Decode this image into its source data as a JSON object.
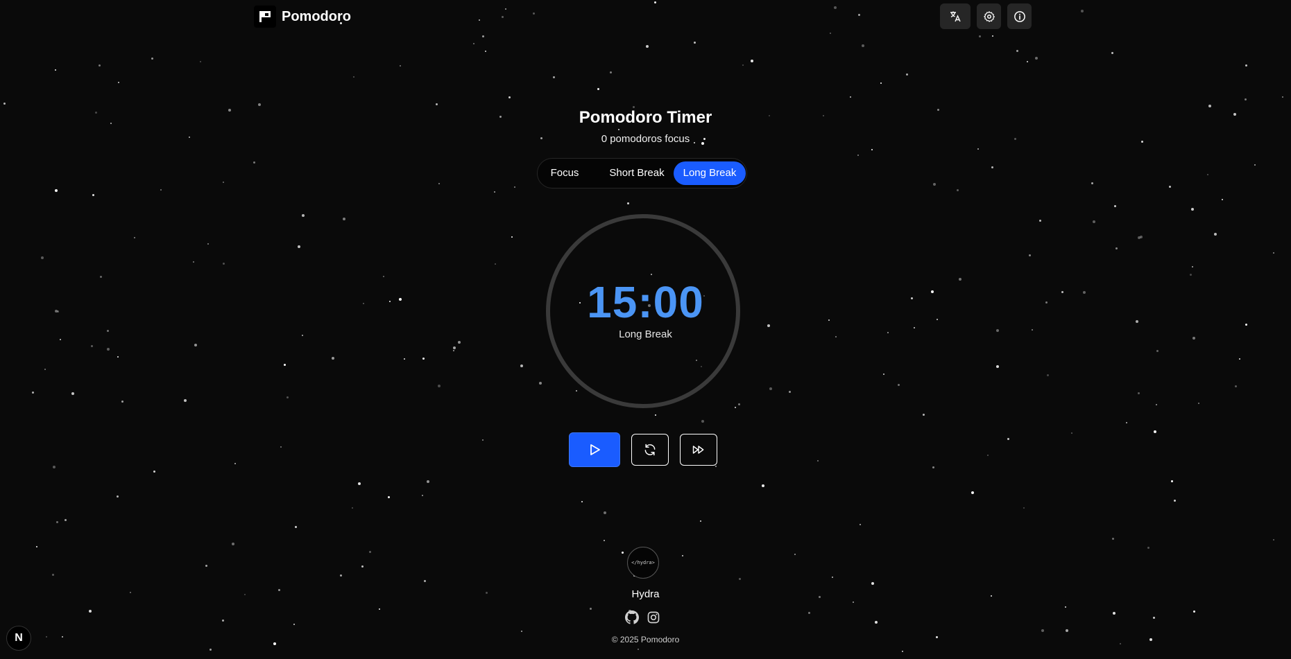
{
  "header": {
    "brand_name": "Pomodoro",
    "icons": [
      "translate-icon",
      "gear-icon",
      "info-icon"
    ]
  },
  "main": {
    "title": "Pomodoro Timer",
    "subtitle": "0 pomodoros focus",
    "tabs": [
      {
        "label": "Focus",
        "active": false
      },
      {
        "label": "Short Break",
        "active": false
      },
      {
        "label": "Long Break",
        "active": true
      }
    ],
    "timer": {
      "time": "15:00",
      "mode_label": "Long Break",
      "time_color": "#4b95f5"
    },
    "controls": [
      "play-icon",
      "refresh-icon",
      "fast-forward-icon"
    ]
  },
  "footer": {
    "avatar_text": "</hydra>",
    "author": "Hydra",
    "socials": [
      "github-icon",
      "instagram-icon"
    ],
    "copyright": "© 2025 Pomodoro"
  },
  "badge": {
    "letter": "N"
  },
  "colors": {
    "accent": "#1a5cff",
    "background": "#0a0a0a",
    "ring": "#3a3a3a"
  }
}
